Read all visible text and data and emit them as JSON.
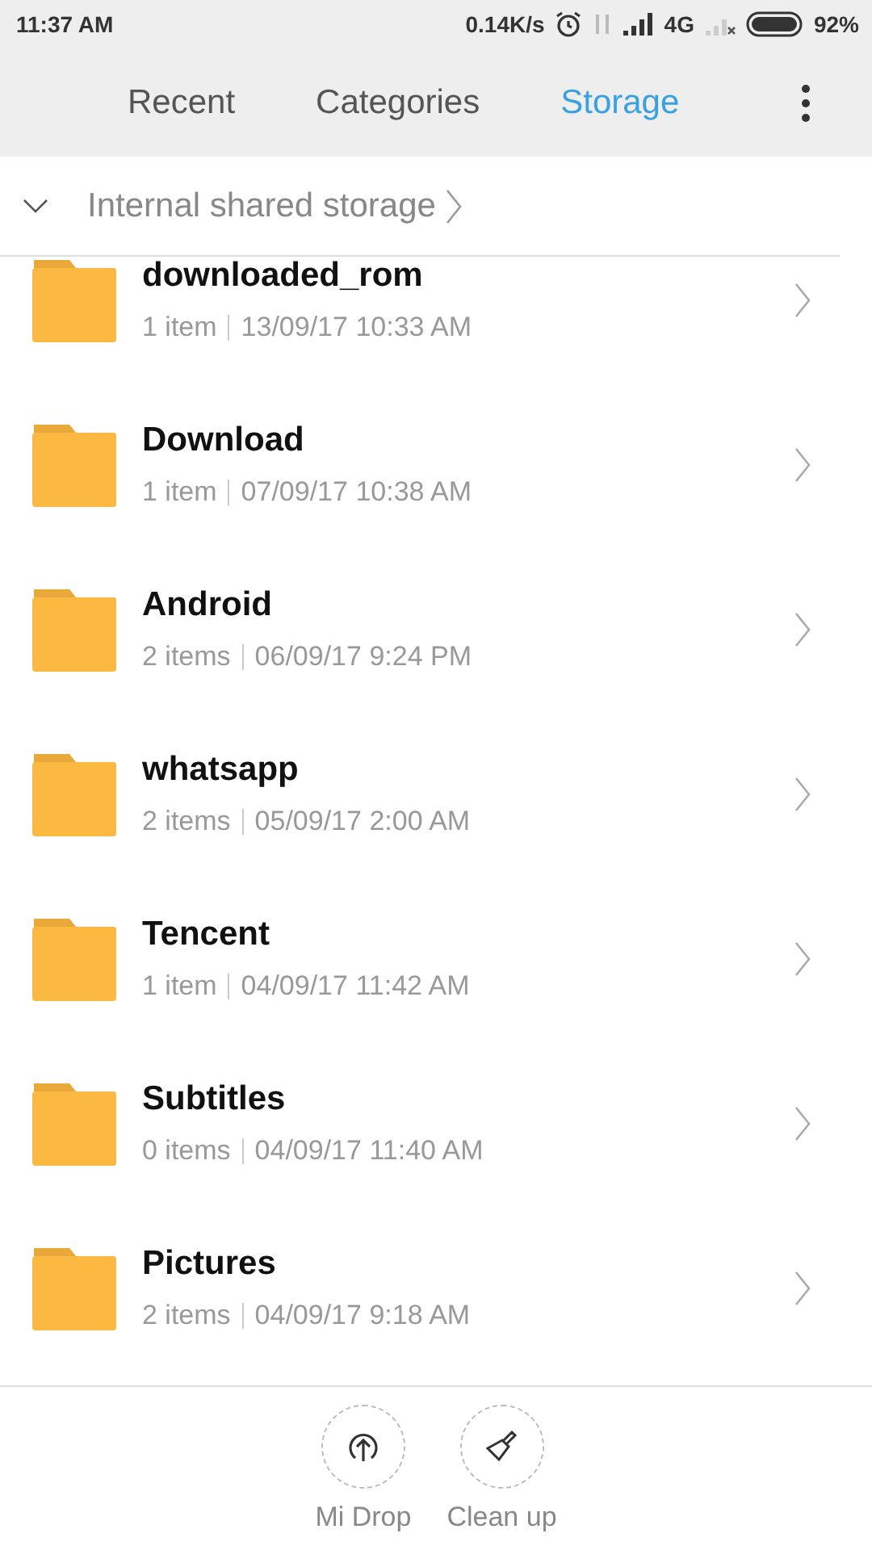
{
  "status_bar": {
    "time": "11:37 AM",
    "speed": "0.14K/s",
    "network": "4G",
    "battery": "92%"
  },
  "tabs": [
    {
      "label": "Recent",
      "selected": false
    },
    {
      "label": "Categories",
      "selected": false
    },
    {
      "label": "Storage",
      "selected": true
    }
  ],
  "breadcrumb": {
    "expanded": true,
    "path": "Internal shared storage"
  },
  "folders": [
    {
      "name": "downloaded_rom",
      "count": "1 item",
      "date": "13/09/17 10:33 AM"
    },
    {
      "name": "Download",
      "count": "1 item",
      "date": "07/09/17 10:38 AM"
    },
    {
      "name": "Android",
      "count": "2 items",
      "date": "06/09/17 9:24 PM"
    },
    {
      "name": "whatsapp",
      "count": "2 items",
      "date": "05/09/17 2:00 AM"
    },
    {
      "name": "Tencent",
      "count": "1 item",
      "date": "04/09/17 11:42 AM"
    },
    {
      "name": "Subtitles",
      "count": "0 items",
      "date": "04/09/17 11:40 AM"
    },
    {
      "name": "Pictures",
      "count": "2 items",
      "date": "04/09/17 9:18 AM"
    }
  ],
  "actions": [
    {
      "kind": "drop",
      "label": "Mi Drop"
    },
    {
      "kind": "clean",
      "label": "Clean up"
    }
  ]
}
